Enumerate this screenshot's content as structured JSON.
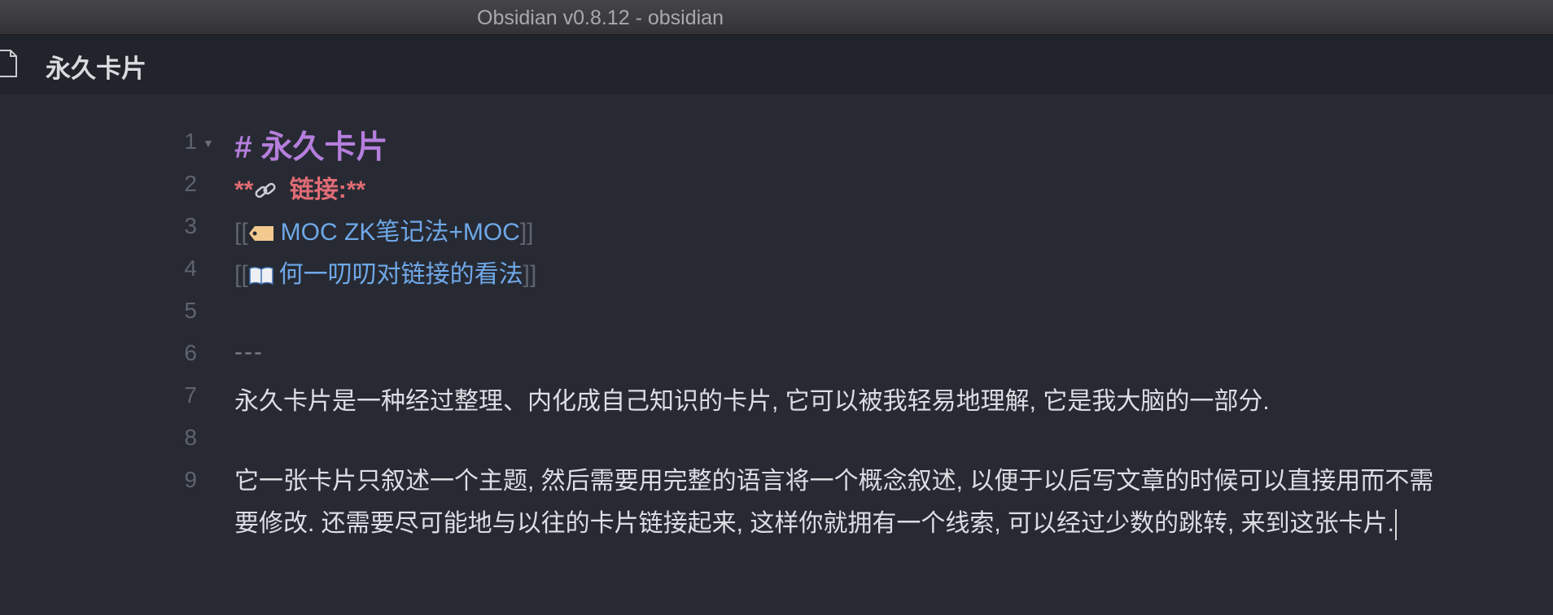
{
  "window": {
    "title": "Obsidian v0.8.12 - obsidian"
  },
  "tab": {
    "title": "永久卡片",
    "icon": "file-icon"
  },
  "editor": {
    "lines": [
      {
        "number": "1",
        "text": "# 永久卡片"
      },
      {
        "number": "2",
        "bold_open": "**",
        "icon": "link-icon",
        "text": " 链接:",
        "bold_close": "**"
      },
      {
        "number": "3",
        "bracket_open": "[[",
        "icon": "tag-icon",
        "link": "MOC ZK笔记法+MOC",
        "bracket_close": "]]"
      },
      {
        "number": "4",
        "bracket_open": "[[",
        "icon": "book-icon",
        "link": "何一叨叨对链接的看法",
        "bracket_close": "]]"
      },
      {
        "number": "5",
        "text": ""
      },
      {
        "number": "6",
        "text": "---"
      },
      {
        "number": "7",
        "text": "永久卡片是一种经过整理、内化成自己知识的卡片, 它可以被我轻易地理解, 它是我大脑的一部分."
      },
      {
        "number": "8",
        "text": ""
      },
      {
        "number": "9",
        "text_line1": "它一张卡片只叙述一个主题, 然后需要用完整的语言将一个概念叙述, 以便于以后写文章的时候可以直接用而不需",
        "text_line2": "要修改. 还需要尽可能地与以往的卡片链接起来, 这样你就拥有一个线索, 可以经过少数的跳转, 来到这张卡片."
      }
    ]
  },
  "colors": {
    "background": "#272a33",
    "heading": "#b57edc",
    "bold": "#e06c75",
    "link": "#6fa8e8"
  }
}
